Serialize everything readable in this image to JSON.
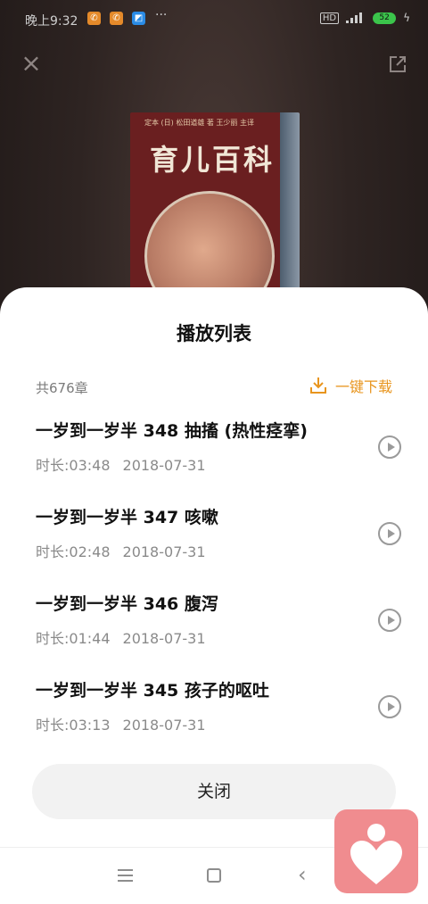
{
  "status_bar": {
    "time": "晚上9:32",
    "dots": "···",
    "battery": "52"
  },
  "cover": {
    "top_text": "定本  (日) 松田道雄 著  王少丽 主译",
    "title": "育儿百科"
  },
  "sheet": {
    "title": "播放列表",
    "count": "共676章",
    "download_label": "一键下载",
    "close_label": "关闭"
  },
  "items": [
    {
      "title": "一岁到一岁半 348 抽搐 (热性痉挛)",
      "duration": "时长:03:48",
      "date": "2018-07-31"
    },
    {
      "title": "一岁到一岁半 347 咳嗽",
      "duration": "时长:02:48",
      "date": "2018-07-31"
    },
    {
      "title": "一岁到一岁半 346 腹泻",
      "duration": "时长:01:44",
      "date": "2018-07-31"
    },
    {
      "title": "一岁到一岁半 345 孩子的呕吐",
      "duration": "时长:03:13",
      "date": "2018-07-31"
    }
  ],
  "colors": {
    "accent": "#e8951e",
    "float_logo": "#f08c8f"
  },
  "icons": {
    "close": "close-icon",
    "share": "share-icon",
    "download": "download-icon",
    "play": "play-circle-icon",
    "menu": "menu-icon",
    "home": "home-icon",
    "back": "back-icon",
    "logo": "heart-logo-icon"
  }
}
